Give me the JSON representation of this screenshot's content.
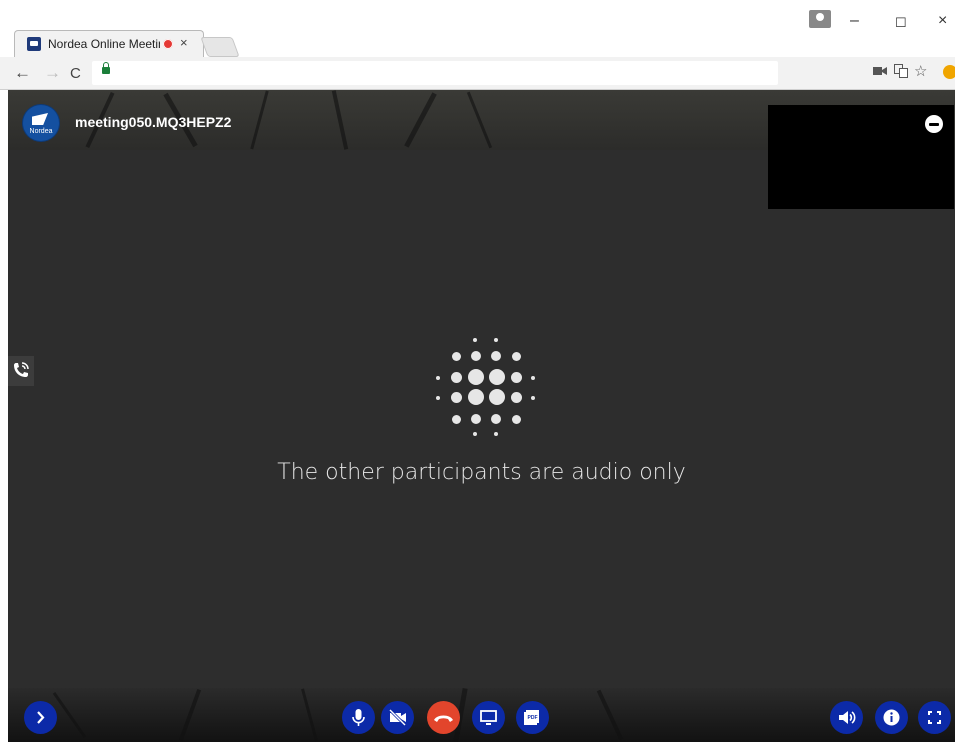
{
  "browser": {
    "tab_title": "Nordea Online Meetin",
    "tab_close": "×",
    "window_controls": {
      "minimize": "–",
      "maximize": "☐",
      "close": "×"
    },
    "nav": {
      "back": "←",
      "forward": "→",
      "reload": "C"
    },
    "url": "",
    "toolbar_icons": [
      "camera-icon",
      "translate-icon",
      "star-icon",
      "extension-icon"
    ]
  },
  "meeting": {
    "logo_text": "Nordea",
    "id": "meeting050.MQ3HEPZ2",
    "status": "The other participants are audio only",
    "accent": "#0c2aa8",
    "hangup_color": "#e2452c"
  },
  "controls": {
    "left": [
      "chevron-right-icon"
    ],
    "center": [
      "microphone-icon",
      "video-off-icon",
      "hang-up-icon",
      "screen-share-icon",
      "pdf-icon"
    ],
    "right": [
      "speaker-icon",
      "info-icon",
      "fullscreen-icon"
    ]
  }
}
